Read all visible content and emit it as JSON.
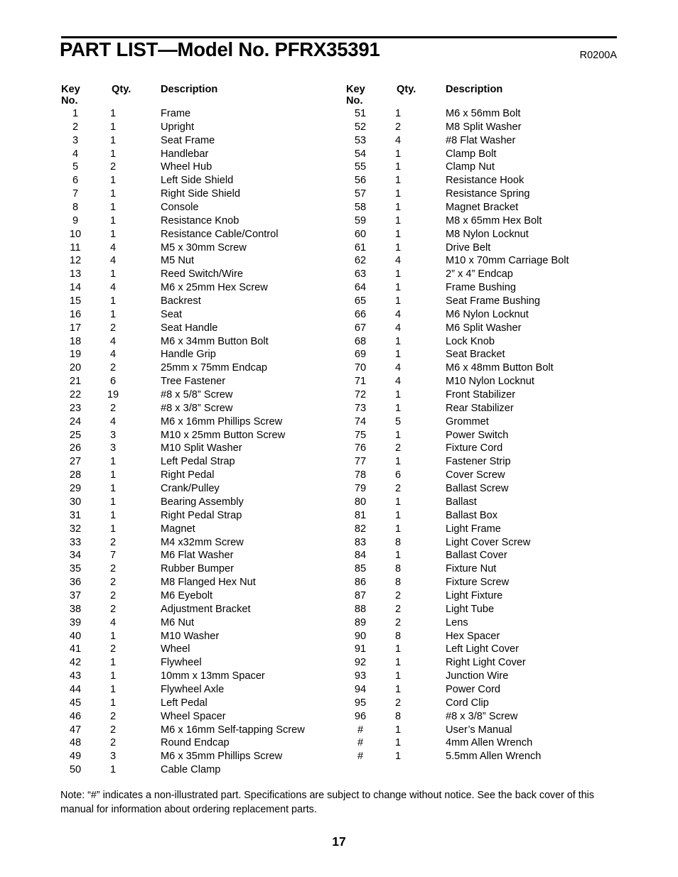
{
  "document": {
    "title": "PART LIST—Model No. PFRX35391",
    "revision_code": "R0200A",
    "page_number": "17",
    "footer_note": "Note: “#” indicates a non-illustrated part. Specifications are subject to change without notice. See the back cover of this manual for information about ordering replacement parts."
  },
  "table": {
    "headers": {
      "key_no": "Key No.",
      "qty": "Qty.",
      "description": "Description"
    },
    "left_column": [
      {
        "key": "1",
        "qty": "1",
        "desc": "Frame"
      },
      {
        "key": "2",
        "qty": "1",
        "desc": "Upright"
      },
      {
        "key": "3",
        "qty": "1",
        "desc": "Seat Frame"
      },
      {
        "key": "4",
        "qty": "1",
        "desc": "Handlebar"
      },
      {
        "key": "5",
        "qty": "2",
        "desc": "Wheel Hub"
      },
      {
        "key": "6",
        "qty": "1",
        "desc": "Left Side Shield"
      },
      {
        "key": "7",
        "qty": "1",
        "desc": "Right Side Shield"
      },
      {
        "key": "8",
        "qty": "1",
        "desc": "Console"
      },
      {
        "key": "9",
        "qty": "1",
        "desc": "Resistance Knob"
      },
      {
        "key": "10",
        "qty": "1",
        "desc": "Resistance Cable/Control"
      },
      {
        "key": "11",
        "qty": "4",
        "desc": "M5 x 30mm Screw"
      },
      {
        "key": "12",
        "qty": "4",
        "desc": "M5 Nut"
      },
      {
        "key": "13",
        "qty": "1",
        "desc": "Reed Switch/Wire"
      },
      {
        "key": "14",
        "qty": "4",
        "desc": "M6 x 25mm Hex Screw"
      },
      {
        "key": "15",
        "qty": "1",
        "desc": "Backrest"
      },
      {
        "key": "16",
        "qty": "1",
        "desc": "Seat"
      },
      {
        "key": "17",
        "qty": "2",
        "desc": "Seat Handle"
      },
      {
        "key": "18",
        "qty": "4",
        "desc": "M6 x 34mm Button Bolt"
      },
      {
        "key": "19",
        "qty": "4",
        "desc": "Handle Grip"
      },
      {
        "key": "20",
        "qty": "2",
        "desc": "25mm x 75mm Endcap"
      },
      {
        "key": "21",
        "qty": "6",
        "desc": "Tree Fastener"
      },
      {
        "key": "22",
        "qty": "19",
        "desc": "#8 x 5/8” Screw"
      },
      {
        "key": "23",
        "qty": "2",
        "desc": "#8 x 3/8” Screw"
      },
      {
        "key": "24",
        "qty": "4",
        "desc": "M6 x 16mm Phillips Screw"
      },
      {
        "key": "25",
        "qty": "3",
        "desc": "M10 x 25mm Button Screw"
      },
      {
        "key": "26",
        "qty": "3",
        "desc": "M10 Split Washer"
      },
      {
        "key": "27",
        "qty": "1",
        "desc": "Left Pedal Strap"
      },
      {
        "key": "28",
        "qty": "1",
        "desc": "Right Pedal"
      },
      {
        "key": "29",
        "qty": "1",
        "desc": "Crank/Pulley"
      },
      {
        "key": "30",
        "qty": "1",
        "desc": "Bearing Assembly"
      },
      {
        "key": "31",
        "qty": "1",
        "desc": "Right Pedal Strap"
      },
      {
        "key": "32",
        "qty": "1",
        "desc": "Magnet"
      },
      {
        "key": "33",
        "qty": "2",
        "desc": "M4 x32mm Screw"
      },
      {
        "key": "34",
        "qty": "7",
        "desc": "M6 Flat Washer"
      },
      {
        "key": "35",
        "qty": "2",
        "desc": "Rubber Bumper"
      },
      {
        "key": "36",
        "qty": "2",
        "desc": "M8 Flanged Hex Nut"
      },
      {
        "key": "37",
        "qty": "2",
        "desc": "M6 Eyebolt"
      },
      {
        "key": "38",
        "qty": "2",
        "desc": "Adjustment Bracket"
      },
      {
        "key": "39",
        "qty": "4",
        "desc": "M6 Nut"
      },
      {
        "key": "40",
        "qty": "1",
        "desc": "M10 Washer"
      },
      {
        "key": "41",
        "qty": "2",
        "desc": "Wheel"
      },
      {
        "key": "42",
        "qty": "1",
        "desc": "Flywheel"
      },
      {
        "key": "43",
        "qty": "1",
        "desc": "10mm x 13mm Spacer"
      },
      {
        "key": "44",
        "qty": "1",
        "desc": "Flywheel Axle"
      },
      {
        "key": "45",
        "qty": "1",
        "desc": "Left Pedal"
      },
      {
        "key": "46",
        "qty": "2",
        "desc": "Wheel Spacer"
      },
      {
        "key": "47",
        "qty": "2",
        "desc": "M6 x 16mm Self-tapping Screw"
      },
      {
        "key": "48",
        "qty": "2",
        "desc": "Round Endcap"
      },
      {
        "key": "49",
        "qty": "3",
        "desc": "M6 x 35mm Phillips Screw"
      },
      {
        "key": "50",
        "qty": "1",
        "desc": "Cable Clamp"
      }
    ],
    "right_column": [
      {
        "key": "51",
        "qty": "1",
        "desc": "M6 x 56mm Bolt"
      },
      {
        "key": "52",
        "qty": "2",
        "desc": "M8 Split Washer"
      },
      {
        "key": "53",
        "qty": "4",
        "desc": "#8 Flat Washer"
      },
      {
        "key": "54",
        "qty": "1",
        "desc": "Clamp Bolt"
      },
      {
        "key": "55",
        "qty": "1",
        "desc": "Clamp Nut"
      },
      {
        "key": "56",
        "qty": "1",
        "desc": "Resistance Hook"
      },
      {
        "key": "57",
        "qty": "1",
        "desc": "Resistance Spring"
      },
      {
        "key": "58",
        "qty": "1",
        "desc": "Magnet Bracket"
      },
      {
        "key": "59",
        "qty": "1",
        "desc": "M8 x 65mm Hex Bolt"
      },
      {
        "key": "60",
        "qty": "1",
        "desc": "M8 Nylon Locknut"
      },
      {
        "key": "61",
        "qty": "1",
        "desc": "Drive Belt"
      },
      {
        "key": "62",
        "qty": "4",
        "desc": "M10 x 70mm Carriage Bolt"
      },
      {
        "key": "63",
        "qty": "1",
        "desc": "2” x 4” Endcap"
      },
      {
        "key": "64",
        "qty": "1",
        "desc": "Frame Bushing"
      },
      {
        "key": "65",
        "qty": "1",
        "desc": "Seat Frame Bushing"
      },
      {
        "key": "66",
        "qty": "4",
        "desc": "M6 Nylon Locknut"
      },
      {
        "key": "67",
        "qty": "4",
        "desc": "M6 Split Washer"
      },
      {
        "key": "68",
        "qty": "1",
        "desc": "Lock Knob"
      },
      {
        "key": "69",
        "qty": "1",
        "desc": "Seat Bracket"
      },
      {
        "key": "70",
        "qty": "4",
        "desc": "M6 x 48mm Button Bolt"
      },
      {
        "key": "71",
        "qty": "4",
        "desc": "M10 Nylon Locknut"
      },
      {
        "key": "72",
        "qty": "1",
        "desc": "Front Stabilizer"
      },
      {
        "key": "73",
        "qty": "1",
        "desc": "Rear Stabilizer"
      },
      {
        "key": "74",
        "qty": "5",
        "desc": "Grommet"
      },
      {
        "key": "75",
        "qty": "1",
        "desc": "Power Switch"
      },
      {
        "key": "76",
        "qty": "2",
        "desc": "Fixture Cord"
      },
      {
        "key": "77",
        "qty": "1",
        "desc": "Fastener Strip"
      },
      {
        "key": "78",
        "qty": "6",
        "desc": "Cover Screw"
      },
      {
        "key": "79",
        "qty": "2",
        "desc": "Ballast Screw"
      },
      {
        "key": "80",
        "qty": "1",
        "desc": "Ballast"
      },
      {
        "key": "81",
        "qty": "1",
        "desc": "Ballast Box"
      },
      {
        "key": "82",
        "qty": "1",
        "desc": "Light Frame"
      },
      {
        "key": "83",
        "qty": "8",
        "desc": "Light Cover Screw"
      },
      {
        "key": "84",
        "qty": "1",
        "desc": "Ballast Cover"
      },
      {
        "key": "85",
        "qty": "8",
        "desc": "Fixture Nut"
      },
      {
        "key": "86",
        "qty": "8",
        "desc": "Fixture Screw"
      },
      {
        "key": "87",
        "qty": "2",
        "desc": "Light Fixture"
      },
      {
        "key": "88",
        "qty": "2",
        "desc": "Light Tube"
      },
      {
        "key": "89",
        "qty": "2",
        "desc": "Lens"
      },
      {
        "key": "90",
        "qty": "8",
        "desc": "Hex Spacer"
      },
      {
        "key": "91",
        "qty": "1",
        "desc": "Left Light Cover"
      },
      {
        "key": "92",
        "qty": "1",
        "desc": "Right Light Cover"
      },
      {
        "key": "93",
        "qty": "1",
        "desc": "Junction Wire"
      },
      {
        "key": "94",
        "qty": "1",
        "desc": "Power Cord"
      },
      {
        "key": "95",
        "qty": "2",
        "desc": "Cord Clip"
      },
      {
        "key": "96",
        "qty": "8",
        "desc": "#8 x 3/8” Screw"
      },
      {
        "key": "#",
        "qty": "1",
        "desc": "User’s Manual"
      },
      {
        "key": "#",
        "qty": "1",
        "desc": "4mm Allen Wrench"
      },
      {
        "key": "#",
        "qty": "1",
        "desc": "5.5mm Allen Wrench"
      }
    ]
  }
}
